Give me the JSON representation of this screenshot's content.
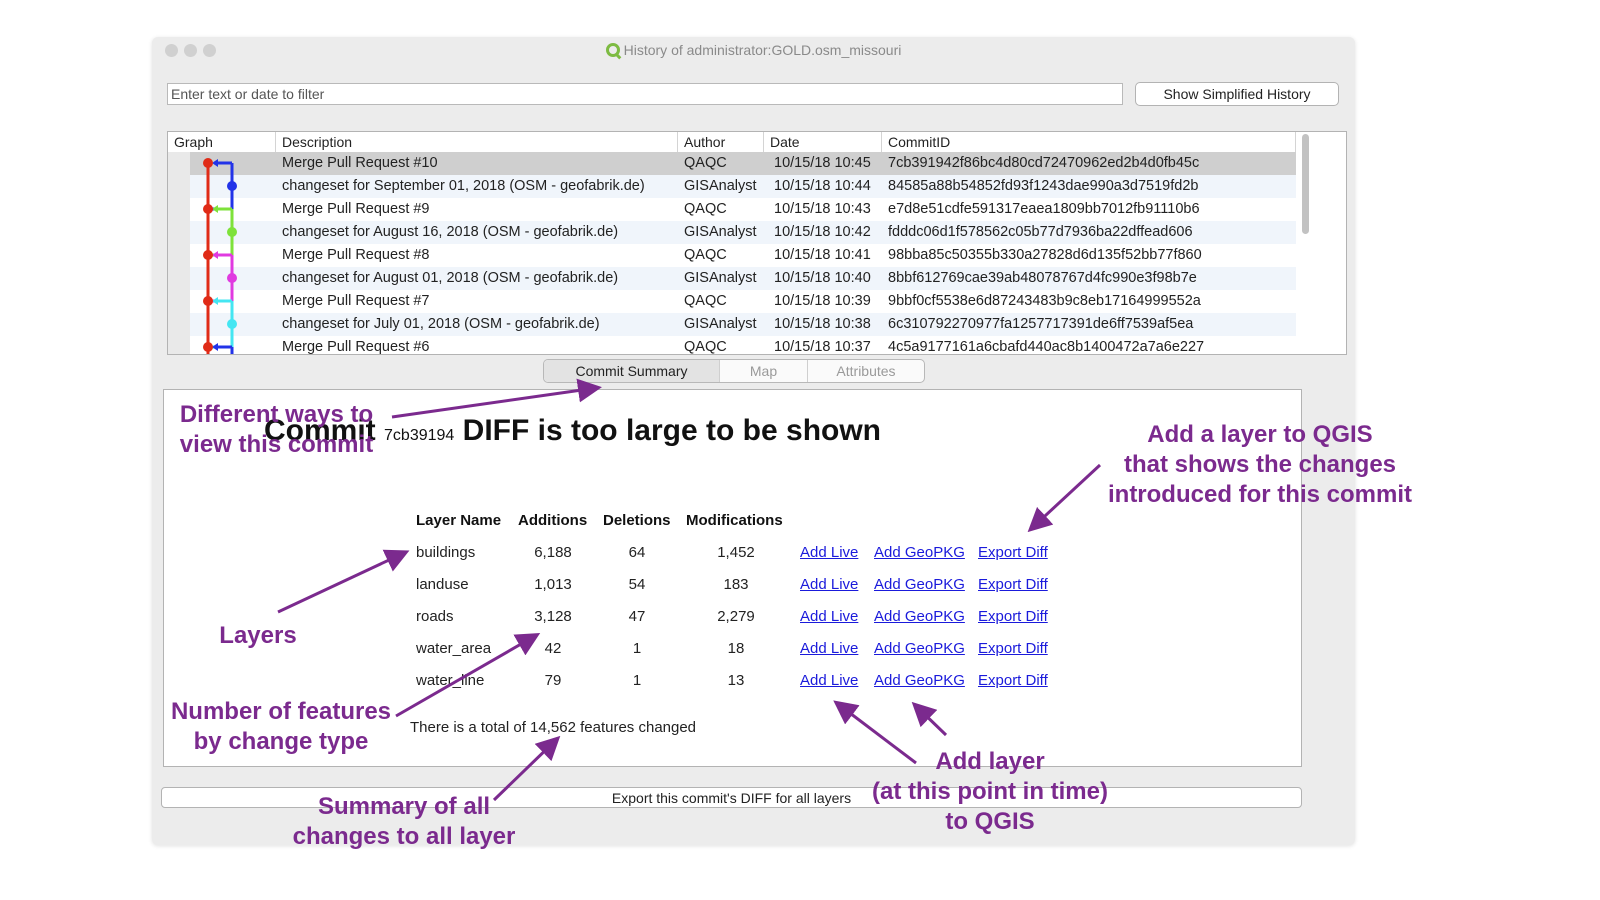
{
  "window": {
    "title": "History of administrator:GOLD.osm_missouri"
  },
  "filter": {
    "placeholder": "Enter text or date to filter",
    "value": ""
  },
  "toolbar": {
    "simplified_label": "Show Simplified History"
  },
  "history": {
    "columns": [
      "Graph",
      "Description",
      "Author",
      "Date",
      "CommitID"
    ],
    "rows": [
      {
        "description": "Merge Pull Request #10",
        "author": "QAQC",
        "date": "10/15/18 10:45",
        "commit": "7cb391942f86bc4d80cd72470962ed2b4d0fb45c"
      },
      {
        "description": "changeset for September 01, 2018 (OSM - geofabrik.de)",
        "author": "GISAnalyst",
        "date": "10/15/18 10:44",
        "commit": "84585a88b54852fd93f1243dae990a3d7519fd2b"
      },
      {
        "description": "Merge Pull Request #9",
        "author": "QAQC",
        "date": "10/15/18 10:43",
        "commit": "e7d8e51cdfe591317eaea1809bb7012fb91110b6"
      },
      {
        "description": "changeset for August 16, 2018 (OSM - geofabrik.de)",
        "author": "GISAnalyst",
        "date": "10/15/18 10:42",
        "commit": "fdddc06d1f578562c05b77d7936ba22dffead606"
      },
      {
        "description": "Merge Pull Request #8",
        "author": "QAQC",
        "date": "10/15/18 10:41",
        "commit": "98bba85c50355b330a27828d6d135f52bb77f860"
      },
      {
        "description": "changeset for August 01, 2018 (OSM - geofabrik.de)",
        "author": "GISAnalyst",
        "date": "10/15/18 10:40",
        "commit": "8bbf612769cae39ab48078767d4fc990e3f98b7e"
      },
      {
        "description": "Merge Pull Request #7",
        "author": "QAQC",
        "date": "10/15/18 10:39",
        "commit": "9bbf0cf5538e6d87243483b9c8eb17164999552a"
      },
      {
        "description": "changeset for July 01, 2018 (OSM - geofabrik.de)",
        "author": "GISAnalyst",
        "date": "10/15/18 10:38",
        "commit": "6c310792270977fa1257717391de6ff7539af5ea"
      },
      {
        "description": "Merge Pull Request #6",
        "author": "QAQC",
        "date": "10/15/18 10:37",
        "commit": "4c5a9177161a6cbafd440ac8b1400472a7a6e227"
      }
    ],
    "graph_colors": [
      "#e02b17",
      "#2233e8",
      "#7ee23a",
      "#e03ae0",
      "#44e6f2"
    ]
  },
  "tabs": [
    "Commit Summary",
    "Map",
    "Attributes"
  ],
  "summary": {
    "commit_label": "Commit",
    "commit_short": "7cb39194",
    "diff_msg": "DIFF is too large to be shown",
    "headers": [
      "Layer Name",
      "Additions",
      "Deletions",
      "Modifications"
    ],
    "layers": [
      {
        "name": "buildings",
        "additions": "6,188",
        "deletions": "64",
        "modifications": "1,452"
      },
      {
        "name": "landuse",
        "additions": "1,013",
        "deletions": "54",
        "modifications": "183"
      },
      {
        "name": "roads",
        "additions": "3,128",
        "deletions": "47",
        "modifications": "2,279"
      },
      {
        "name": "water_area",
        "additions": "42",
        "deletions": "1",
        "modifications": "18"
      },
      {
        "name": "water_line",
        "additions": "79",
        "deletions": "1",
        "modifications": "13"
      }
    ],
    "links": {
      "add_live": "Add Live",
      "add_geopkg": "Add GeoPKG",
      "export_diff": "Export Diff"
    },
    "total": "There is a total of 14,562 features changed"
  },
  "export_all_label": "Export this commit's DIFF for all layers",
  "annotations": {
    "views": "Different ways to\nview this commit",
    "add_layer_changes": "Add a layer to QGIS\nthat shows the changes\nintroduced for this commit",
    "layers": "Layers",
    "num_features": "Number of features\nby change type",
    "summary_all": "Summary of all\nchanges to all layer",
    "add_layer_time": "Add layer\n(at this point in time)\nto QGIS",
    "color": "#7b2a8e"
  }
}
